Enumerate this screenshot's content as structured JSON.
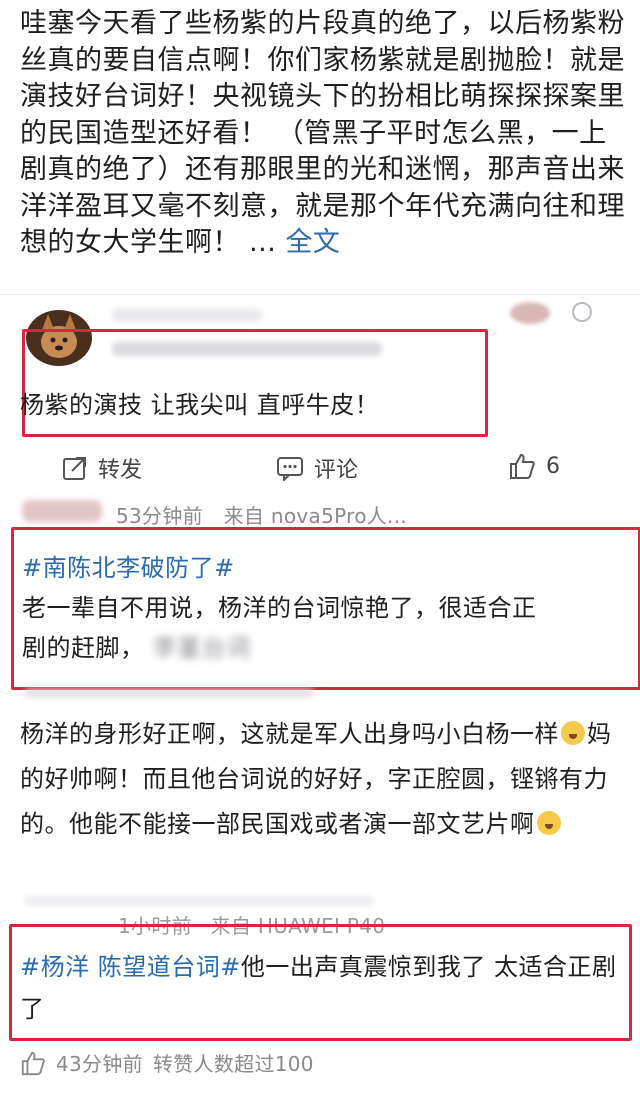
{
  "post": {
    "text": "哇塞今天看了些杨紫的片段真的绝了，以后杨紫粉丝真的要自信点啊！你们家杨紫就是剧抛脸！就是演技好台词好！央视镜头下的扮相比萌探探探案里的民国造型还好看！ （管黑子平时怎么黑，一上剧真的绝了）还有那眼里的光和迷惘，那声音出来洋洋盈耳又毫不刻意，就是那个年代充满向往和理想的女大学生啊！ ...",
    "more_label": "全文"
  },
  "first_comment": {
    "text": "杨紫的演技 让我尖叫 直呼牛皮！"
  },
  "actions": {
    "repost_label": "转发",
    "comment_label": "评论",
    "like_count": "6"
  },
  "comment_meta_1": {
    "time": "53分钟前",
    "source": "来自 nova5Pro人..."
  },
  "comment_2": {
    "tag": "#南陈北李破防了#",
    "text_line1": "老一辈自不用说，杨洋的台词惊艳了，很适合正",
    "text_line2": "剧的赶脚，",
    "blurred_suffix": "李堇台词"
  },
  "comment_3": {
    "text": "杨洋的身形好正啊，这就是军人出身吗小白杨一样",
    "text_2": "妈的好帅啊！而且他台词说的好好，字正腔圆，铿锵有力的。他能不能接一部民国戏或者演一部文艺片啊"
  },
  "comment_meta_2": {
    "time": "1小时前",
    "source": "来自 HUAWEI P40"
  },
  "comment_4": {
    "tag": "#杨洋 陈望道台词#",
    "text": "他一出声真震惊到我了 太适合正剧了"
  },
  "bottom_meta": {
    "time": "43分钟前",
    "reposts": "转赞人数超过100"
  },
  "colors": {
    "tag_blue": "#2a6bb0",
    "highlight_red": "#d7263d",
    "text": "#1f1f1f",
    "muted": "#8a8a8a"
  }
}
